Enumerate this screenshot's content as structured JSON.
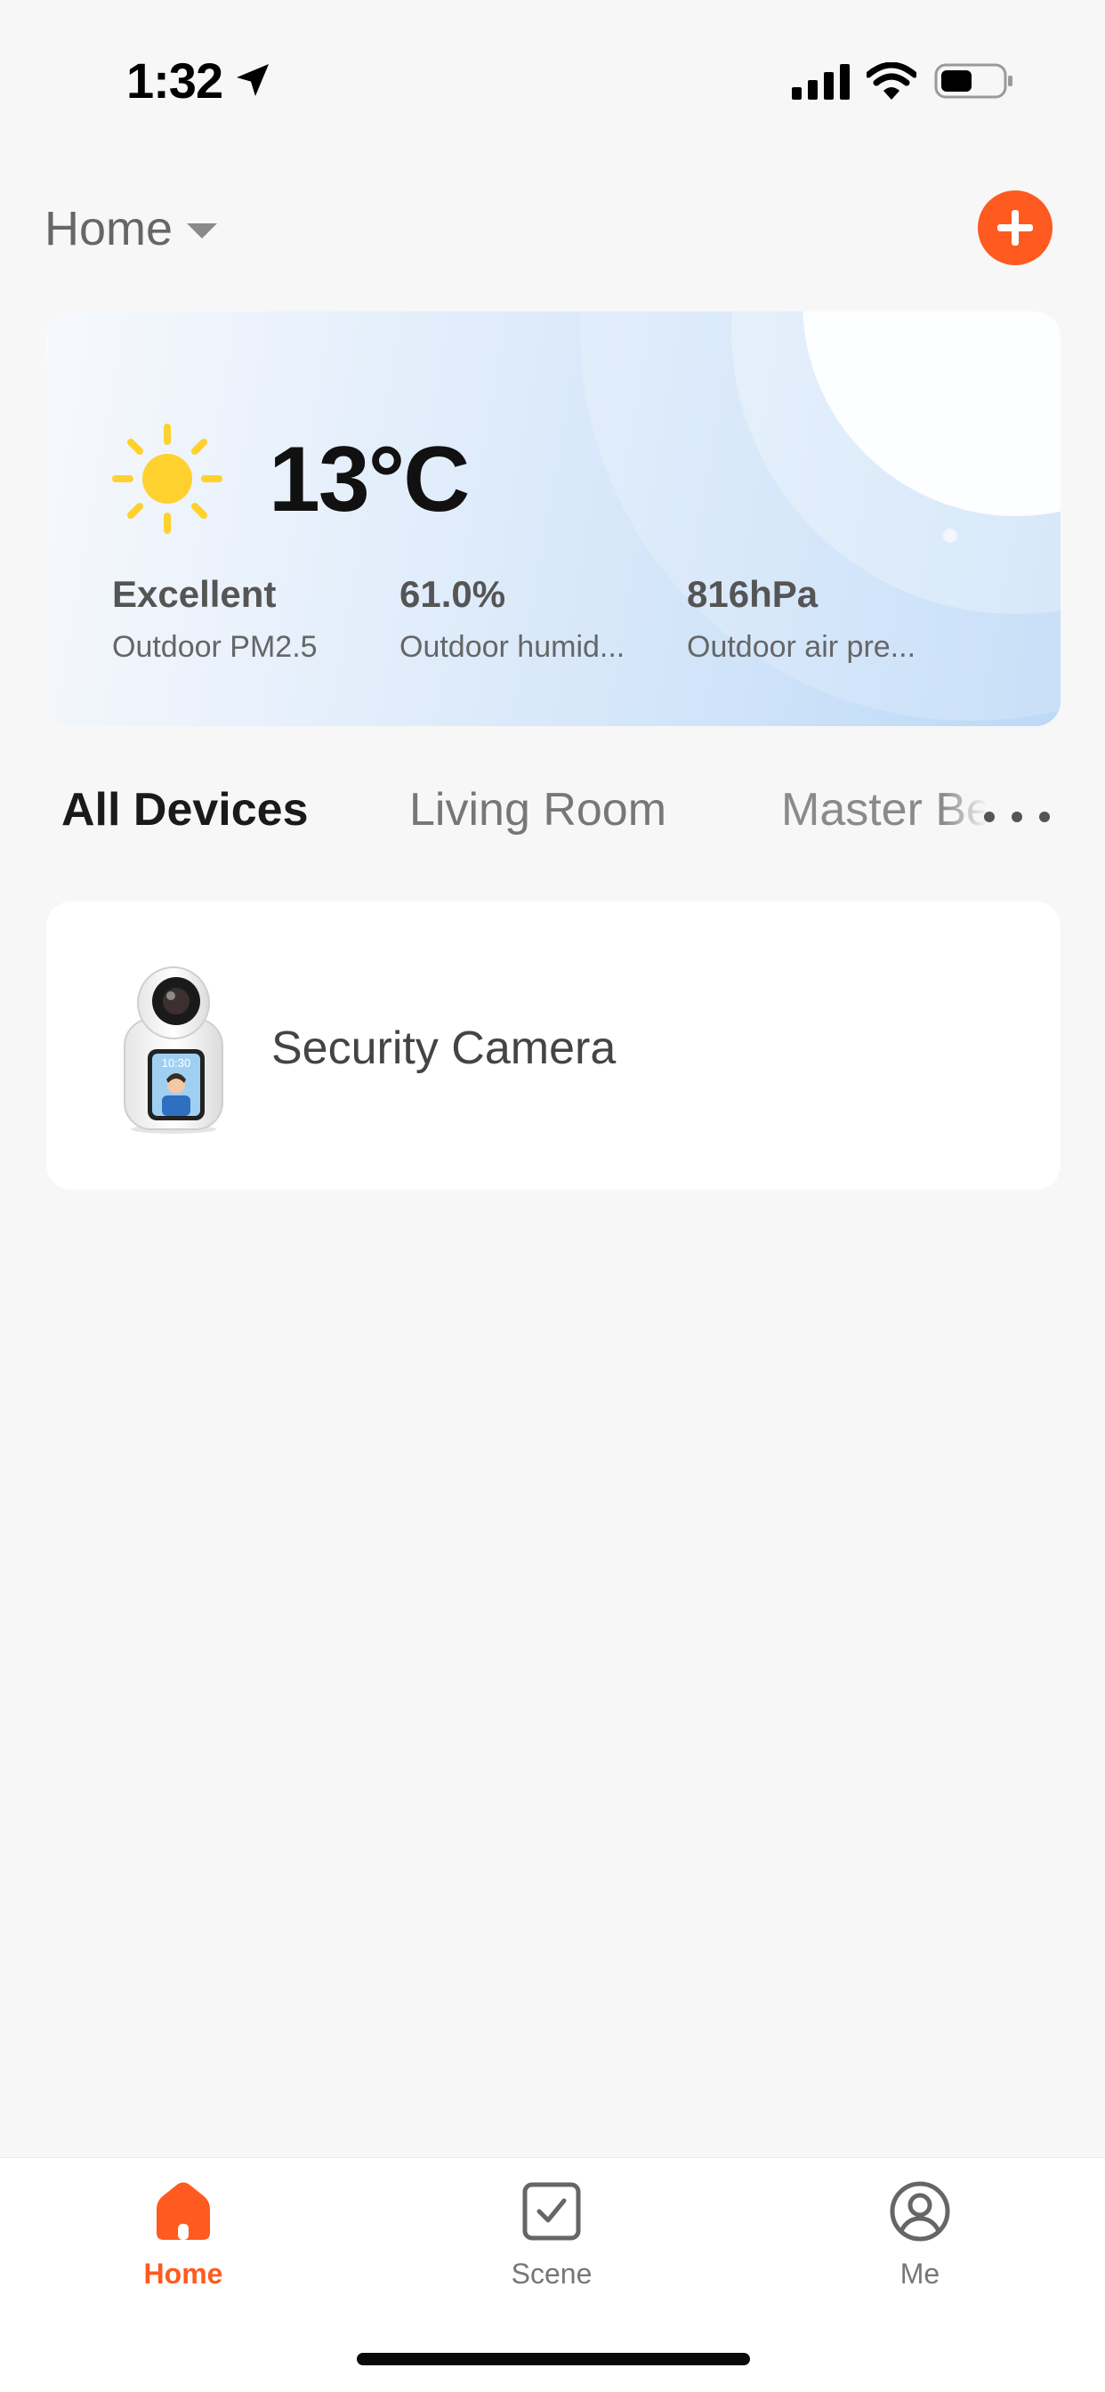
{
  "status_bar": {
    "time": "1:32",
    "icons": [
      "location-arrow-icon",
      "cellular-signal-icon",
      "wifi-icon",
      "battery-icon"
    ]
  },
  "header": {
    "home_label": "Home",
    "add_icon": "plus-circle-icon",
    "accent_color": "#ff5a1f"
  },
  "weather": {
    "icon": "sun-icon",
    "temperature": "13°C",
    "metrics": [
      {
        "value": "Excellent",
        "label": "Outdoor PM2.5"
      },
      {
        "value": "61.0%",
        "label": "Outdoor humid..."
      },
      {
        "value": "816hPa",
        "label": "Outdoor air pre..."
      }
    ]
  },
  "rooms": {
    "tabs": [
      {
        "label": "All Devices",
        "active": true
      },
      {
        "label": "Living Room",
        "active": false
      },
      {
        "label": "Master Bedroom",
        "active": false
      }
    ],
    "more_icon": "more-horizontal-icon"
  },
  "devices": [
    {
      "name": "Security Camera",
      "screen_time": "10:30"
    }
  ],
  "nav": {
    "items": [
      {
        "label": "Home",
        "icon": "home-icon",
        "active": true
      },
      {
        "label": "Scene",
        "icon": "checkbox-icon",
        "active": false
      },
      {
        "label": "Me",
        "icon": "user-circle-icon",
        "active": false
      }
    ]
  }
}
